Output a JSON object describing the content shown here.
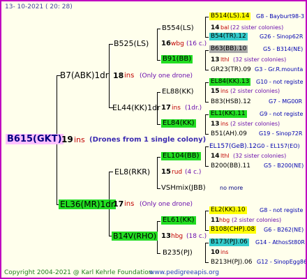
{
  "header": {
    "date": "13- 10-2021 ( 20: 28)"
  },
  "footer": {
    "copyright": "Copyright 2004-2021 @ Karl Kehrle Foundation",
    "site": "www.pedigreeapis.org"
  },
  "colors": {
    "border": "#c000c0",
    "root_bg": "#ffc0ff",
    "green": "#22dd22",
    "yellow": "#ffff00",
    "cyan": "#33cccc",
    "gray": "#aaaaaa"
  },
  "root": {
    "name": "B615(GKT)",
    "num": "19",
    "suffix": "ins",
    "note": "(Drones from 1 single colony)"
  },
  "gen1": {
    "top": {
      "name": "B7(ABK)1dr",
      "num": "18",
      "suffix": "ins",
      "note": "(Only one drone)"
    },
    "bottom": {
      "name": "EL36(MR)1dr",
      "num": "17",
      "suffix": "ins",
      "note": "(Only one drone)"
    }
  },
  "gen2": {
    "a": {
      "name": "B525(LS)",
      "num": "16",
      "suffix": "wbg",
      "note": "(16 c.)"
    },
    "b": {
      "name": "EL44(KK)1dr",
      "num": "17",
      "suffix": "ins",
      "note": "(1dr.)"
    },
    "c": {
      "name": "EL8(RKR)",
      "num": "15",
      "suffix": "rud",
      "note": "(4 c.)"
    },
    "d": {
      "name": "B14V(RHO)",
      "num": "13",
      "suffix": "hbg",
      "note": "(18 c.)"
    }
  },
  "gen3": {
    "a1": {
      "name": "B554(LS)",
      "num": "14",
      "suffix": "bal",
      "note": "(22 sister colonies)"
    },
    "a2": {
      "name": "B91(BB)",
      "num": "13",
      "suffix": "lthl",
      "note": "(32 sister colonies)"
    },
    "b1": {
      "name": "EL88(KK)",
      "num": "15",
      "suffix": "ins",
      "note": "(2 sister colonies)"
    },
    "b2": {
      "name": "EL84(KK)",
      "num": "13",
      "suffix": "ins",
      "note": "(2 sister colonies)"
    },
    "c1": {
      "name": "EL104(BB)",
      "num": "14",
      "suffix": "lthl",
      "note": "(32 sister colonies)"
    },
    "c2": {
      "name": "VSHmix(JBB)",
      "note": "no more"
    },
    "d1": {
      "name": "EL61(KK)",
      "num": "11",
      "suffix": "hbg",
      "note": "(2 sister colonies)"
    },
    "d2": {
      "name": "B235(PJ)",
      "num": "10",
      "suffix": "ins"
    }
  },
  "gen4": [
    {
      "name": "B514(LS).14",
      "info": "G8 - Bayburt98-3"
    },
    {
      "name": "B54(TR).12",
      "info": "G26 - Sinop62R"
    },
    {
      "name": "B63(BB).10",
      "info": "G5 - B314(NE)"
    },
    {
      "name": "GR23(TR).09",
      "info": "G3 - Gr.R.mounta"
    },
    {
      "name": "EL84(KK).13",
      "info": "G10 - not registe"
    },
    {
      "name": "B83(HSB).12",
      "info": "G7 - MG00R"
    },
    {
      "name": "EL1(KK).11",
      "info": "G9 - not registe"
    },
    {
      "name": "B51(AH).09",
      "info": "G19 - Sinop72R"
    },
    {
      "name": "EL157(GeB).12",
      "info": "G0 - EL157(EO)"
    },
    {
      "name": "B200(BB).11",
      "info": "G5 - B200(NE)"
    },
    {
      "name": "EL2(KK).10",
      "info": "G8 - not registe"
    },
    {
      "name": "B108(CHP).08",
      "info": "G6 - B262(NE)"
    },
    {
      "name": "B173(PJ).06",
      "info": "G14 - AthosSt80R"
    },
    {
      "name": "B213H(PJ).06",
      "info": "G12 - SinopEgg86R"
    }
  ]
}
